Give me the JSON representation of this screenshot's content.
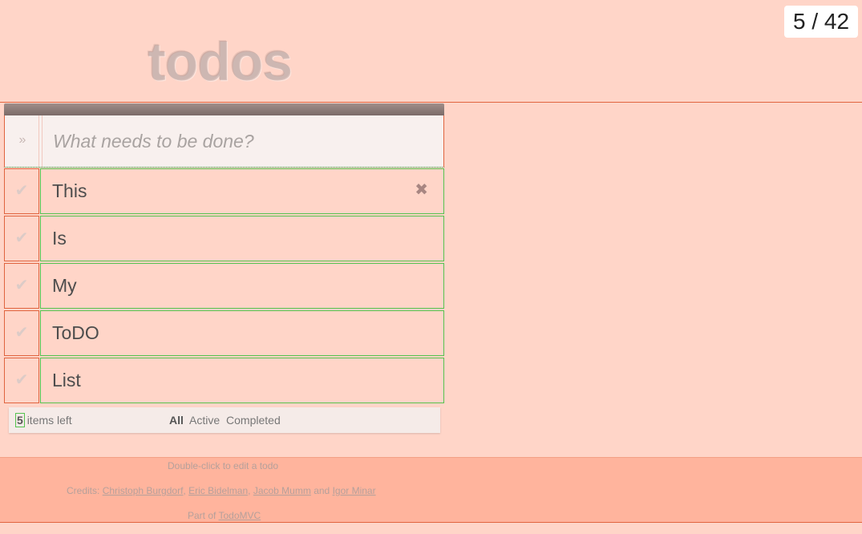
{
  "counter": "5 / 42",
  "app": {
    "title": "todos",
    "new_todo_placeholder": "What needs to be done?",
    "toggle_all_icon": "double-chevron-down-icon",
    "todos": [
      {
        "label": "This",
        "completed": false,
        "show_destroy": true
      },
      {
        "label": "Is",
        "completed": false
      },
      {
        "label": "My",
        "completed": false
      },
      {
        "label": "ToDO",
        "completed": false
      },
      {
        "label": "List",
        "completed": false
      }
    ],
    "footer": {
      "count": "5",
      "count_suffix": "items left",
      "filters": [
        "All",
        "Active",
        "Completed"
      ],
      "selected_filter": "All"
    }
  },
  "info": {
    "edit_hint": "Double-click to edit a todo",
    "credits_prefix": "Credits:",
    "credits": [
      "Christoph Burgdorf",
      "Eric Bidelman",
      "Jacob Mumm",
      "Igor Minar"
    ],
    "credits_sep": ",",
    "credits_and": "and",
    "part_of_prefix": "Part of",
    "part_of_link": "TodoMVC"
  },
  "colors": {
    "page_bg": "#ffd5c8",
    "info_bg": "#ffb49d",
    "outline_red": "#e0643f",
    "outline_green": "#55c24f"
  }
}
